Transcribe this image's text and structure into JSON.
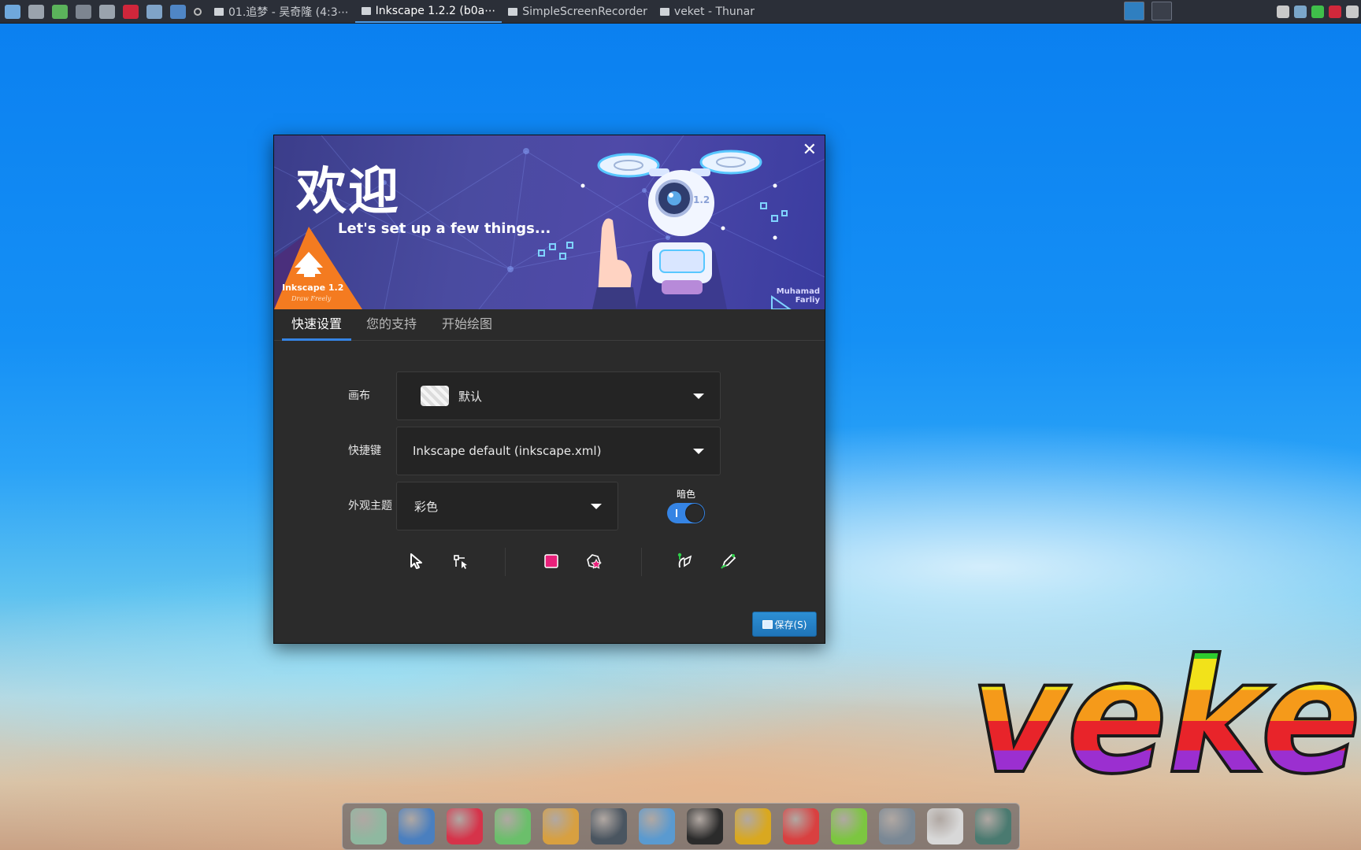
{
  "top_panel": {
    "launchers": [
      {
        "name": "system-monitor-icon",
        "color": "#6fa8dc"
      },
      {
        "name": "settings-gear-icon",
        "color": "#9aa3ad"
      },
      {
        "name": "play-icon",
        "color": "#5bb35b"
      },
      {
        "name": "terminal-icon",
        "color": "#7d8590"
      },
      {
        "name": "screenshot-icon",
        "color": "#9aa3ad"
      },
      {
        "name": "heart-app-icon",
        "color": "#d0263b"
      },
      {
        "name": "app-icon",
        "color": "#7fa3c8"
      },
      {
        "name": "browser-icon",
        "color": "#4f86c6"
      }
    ],
    "tasks": [
      {
        "title": "01.追梦 - 吴奇隆 (4:3⋯",
        "active": false
      },
      {
        "title": "Inkscape 1.2.2 (b0a⋯",
        "active": true
      },
      {
        "title": "SimpleScreenRecorder",
        "active": false
      },
      {
        "title": "veket - Thunar",
        "active": false
      }
    ],
    "tray_icons": [
      {
        "name": "clipboard-icon",
        "color": "#c9c9c9"
      },
      {
        "name": "network-icon",
        "color": "#7aa6c9"
      },
      {
        "name": "battery-icon",
        "color": "#3fbf4a"
      },
      {
        "name": "record-icon",
        "color": "#d1283b"
      },
      {
        "name": "keyboard-icon",
        "color": "#c9c9c9"
      }
    ]
  },
  "dialog": {
    "welcome": "欢迎",
    "tagline": "Let's set up a few things...",
    "artist": [
      "Muhamad",
      "Farliy"
    ],
    "logo_text": "Inkscape 1.2",
    "logo_sub": "Draw Freely",
    "close": "✕",
    "tabs": [
      "快速设置",
      "您的支持",
      "开始绘图"
    ],
    "canvas": {
      "label": "画布",
      "value": "默认"
    },
    "shortcuts": {
      "label": "快捷键",
      "value": "Inkscape default (inkscape.xml)"
    },
    "theme": {
      "label": "外观主题",
      "value": "彩色"
    },
    "dark": {
      "label": "暗色",
      "on": true
    },
    "tool_icons": [
      "selector-icon",
      "node-tool-icon",
      "rectangle-icon",
      "star-icon",
      "pen-icon",
      "pencil-icon"
    ],
    "save_label": "保存(S)",
    "accent": "#3584e4"
  },
  "desktop": {
    "logo_text": "veke"
  },
  "dock": {
    "icons": [
      {
        "name": "file-manager-icon",
        "color": "#8fb8a0"
      },
      {
        "name": "computer-icon",
        "color": "#4a7fbf"
      },
      {
        "name": "red-mascot-icon",
        "color": "#d6334a"
      },
      {
        "name": "editor-icon",
        "color": "#6bbf6b"
      },
      {
        "name": "paint-palette-icon",
        "color": "#d8a040"
      },
      {
        "name": "power-icon",
        "color": "#4a5560"
      },
      {
        "name": "users-icon",
        "color": "#5a9ad0"
      },
      {
        "name": "penguin-icon",
        "color": "#2b2b2b"
      },
      {
        "name": "book-icon",
        "color": "#d9a820"
      },
      {
        "name": "chart-icon",
        "color": "#d94040"
      },
      {
        "name": "help-icon",
        "color": "#7cc640"
      },
      {
        "name": "drive-icon",
        "color": "#7a8895"
      },
      {
        "name": "brightness-icon",
        "color": "#d8d8d8"
      },
      {
        "name": "globe-icon",
        "color": "#4a7a70"
      }
    ]
  }
}
